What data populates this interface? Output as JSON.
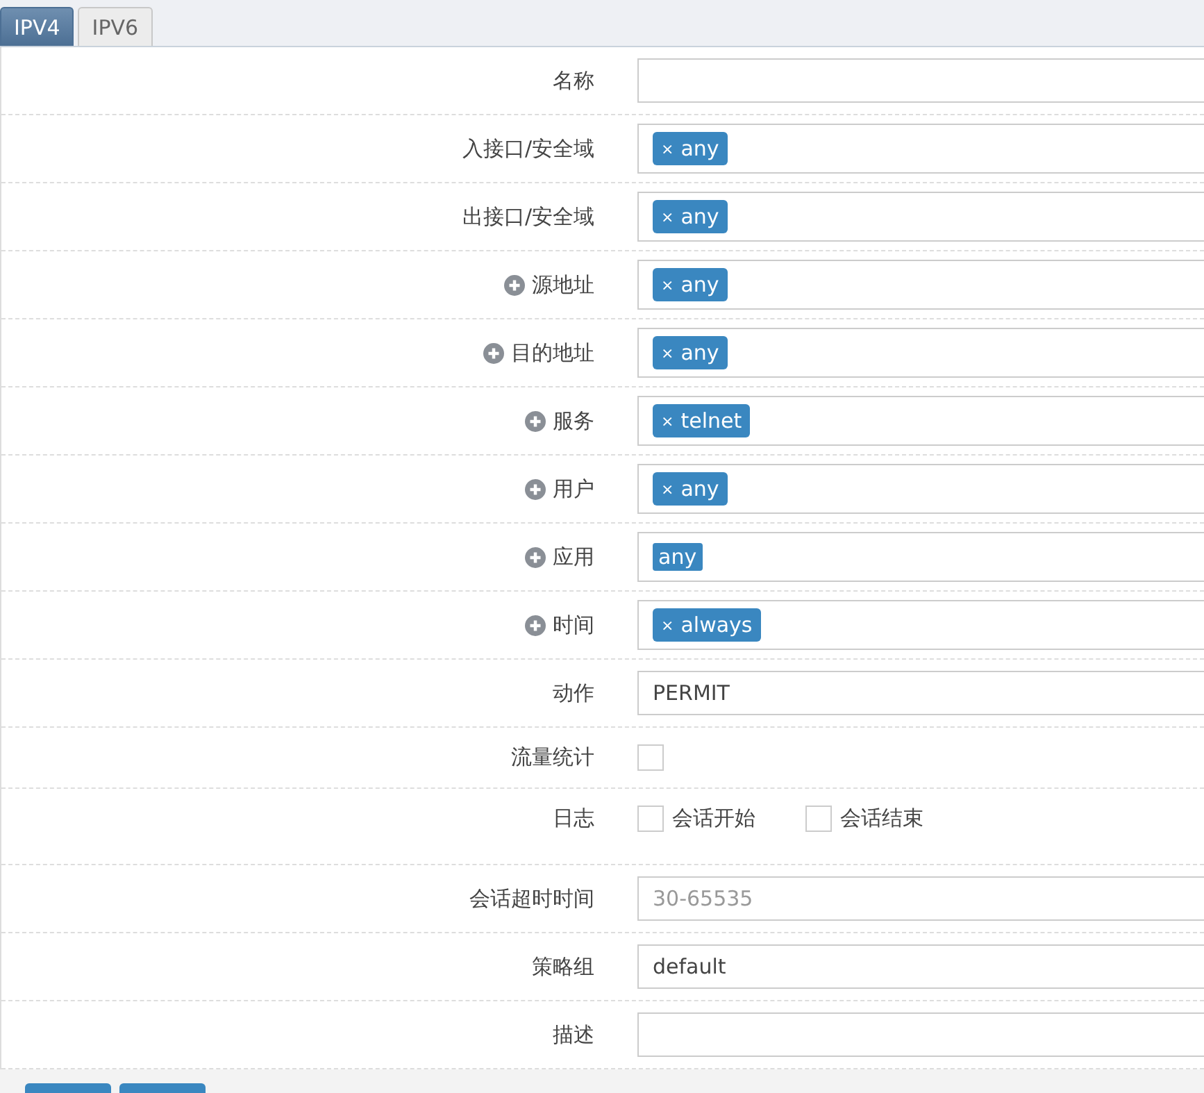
{
  "tabs": [
    {
      "label": "IPV4",
      "selected": true
    },
    {
      "label": "IPV6",
      "selected": false
    }
  ],
  "fields": [
    {
      "kind": "text",
      "label": "名称",
      "addable": false
    },
    {
      "kind": "tags",
      "label": "入接口/安全域",
      "addable": false,
      "tags": [
        {
          "remove": "×",
          "text": "any"
        }
      ]
    },
    {
      "kind": "tags",
      "label": "出接口/安全域",
      "addable": false,
      "tags": [
        {
          "remove": "×",
          "text": "any"
        }
      ]
    },
    {
      "kind": "tags",
      "label": "源地址",
      "addable": true,
      "tags": [
        {
          "remove": "×",
          "text": "any"
        }
      ]
    },
    {
      "kind": "tags",
      "label": "目的地址",
      "addable": true,
      "tags": [
        {
          "remove": "×",
          "text": "any"
        }
      ]
    },
    {
      "kind": "tags",
      "label": "服务",
      "addable": true,
      "tags": [
        {
          "remove": "×",
          "text": "telnet"
        }
      ]
    },
    {
      "kind": "tags",
      "label": "用户",
      "addable": true,
      "tags": [
        {
          "remove": "×",
          "text": "any"
        }
      ]
    },
    {
      "kind": "tags",
      "label": "应用",
      "addable": true,
      "tags": [
        {
          "text": "any"
        }
      ]
    },
    {
      "kind": "tags",
      "label": "时间",
      "addable": true,
      "tags": [
        {
          "remove": "×",
          "text": "always"
        }
      ]
    },
    {
      "kind": "text",
      "label": "动作",
      "addable": false,
      "value": "PERMIT"
    },
    {
      "kind": "checks",
      "label": "流量统计",
      "addable": false,
      "options": [
        {
          "checked": false
        }
      ]
    },
    {
      "kind": "checks",
      "label": "日志",
      "addable": false,
      "options": [
        {
          "text": "会话开始",
          "checked": false
        },
        {
          "text": "会话结束",
          "checked": false
        }
      ]
    },
    {
      "kind": "text",
      "label": "会话超时时间",
      "addable": false,
      "placeholder": "30-65535"
    },
    {
      "kind": "text",
      "label": "策略组",
      "addable": false,
      "value": "default"
    },
    {
      "kind": "text",
      "label": "描述",
      "addable": false
    }
  ]
}
